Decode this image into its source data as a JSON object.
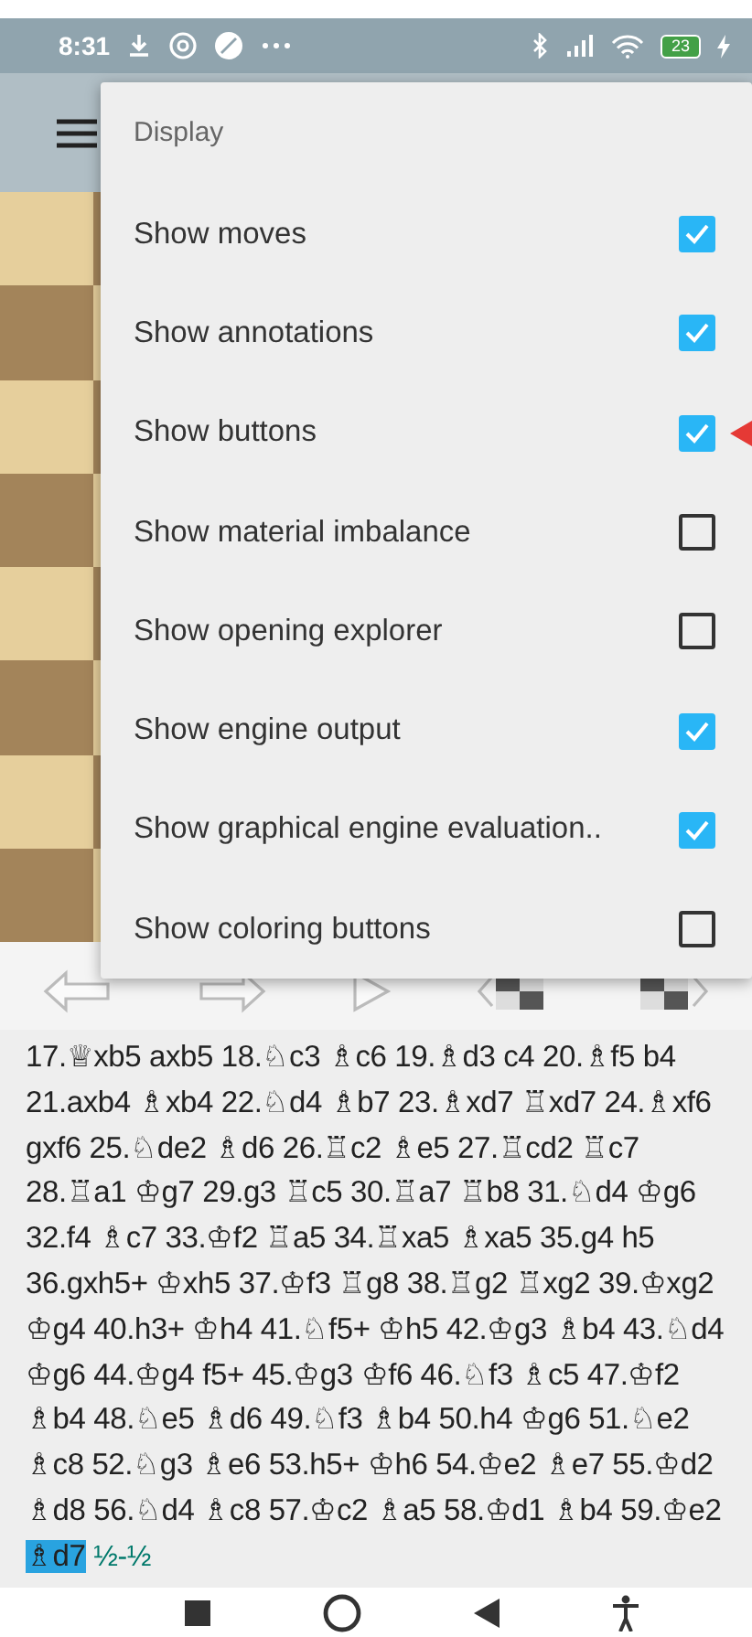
{
  "status_bar": {
    "time": "8:31",
    "battery": "23"
  },
  "menu": {
    "title": "Display",
    "items": [
      {
        "label": "Show moves",
        "checked": true
      },
      {
        "label": "Show annotations",
        "checked": true
      },
      {
        "label": "Show buttons",
        "checked": true
      },
      {
        "label": "Show material imbalance",
        "checked": false
      },
      {
        "label": "Show opening explorer",
        "checked": false
      },
      {
        "label": "Show engine output",
        "checked": true
      },
      {
        "label": "Show graphical engine evaluation..",
        "checked": true
      },
      {
        "label": "Show coloring buttons",
        "checked": false
      }
    ]
  },
  "moves": {
    "text": "17.♕xb5 axb5 18.♘c3 ♗c6 19.♗d3 c4 20.♗f5 b4 21.axb4 ♗xb4 22.♘d4 ♗b7 23.♗xd7 ♖xd7 24.♗xf6 gxf6 25.♘de2 ♗d6 26.♖c2 ♗e5 27.♖cd2 ♖c7 28.♖a1 ♔g7 29.g3 ♖c5 30.♖a7 ♖b8 31.♘d4 ♔g6 32.f4 ♗c7 33.♔f2 ♖a5 34.♖xa5 ♗xa5 35.g4 h5 36.gxh5+ ♔xh5 37.♔f3 ♖g8 38.♖g2 ♖xg2 39.♔xg2 ♔g4 40.h3+ ♔h4 41.♘f5+ ♔h5 42.♔g3 ♗b4 43.♘d4 ♔g6 44.♔g4 f5+ 45.♔g3 ♔f6 46.♘f3 ♗c5 47.♔f2 ♗b4 48.♘e5 ♗d6 49.♘f3 ♗b4 50.h4 ♔g6 51.♘e2 ♗c8 52.♘g3 ♗e6 53.h5+ ♔h6 54.♔e2 ♗e7 55.♔d2 ♗d8 56.♘d4 ♗c8 57.♔c2 ♗a5 58.♔d1 ♗b4 59.♔e2",
    "current_move": "♗d7",
    "result": "½-½"
  }
}
